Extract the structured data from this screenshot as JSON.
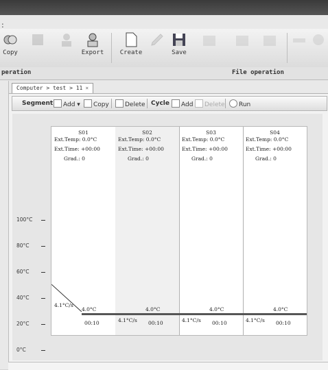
{
  "ribbon": {
    "buttons": [
      {
        "label": "Copy",
        "icon": "copy-icon",
        "enabled": true
      },
      {
        "label": "",
        "icon": "paste-icon",
        "enabled": false
      },
      {
        "label": "",
        "icon": "user-icon",
        "enabled": false
      },
      {
        "label": "Export",
        "icon": "export-icon",
        "enabled": true
      },
      {
        "label": "Create",
        "icon": "new-document-icon",
        "enabled": true
      },
      {
        "label": "",
        "icon": "edit-icon",
        "enabled": false
      },
      {
        "label": "Save",
        "icon": "save-icon",
        "enabled": true
      },
      {
        "label": "",
        "icon": "save-as-icon",
        "enabled": false
      },
      {
        "label": "",
        "icon": "import-icon",
        "enabled": false
      },
      {
        "label": "",
        "icon": "print-icon",
        "enabled": false
      }
    ],
    "groups": [
      "peration",
      "File operation"
    ]
  },
  "document_tab": {
    "label": "Computer > test > 11",
    "close": "×"
  },
  "segment_toolbar": {
    "segment_label": "Segment",
    "add_label": "Add",
    "copy_label": "Copy",
    "delete_label": "Delete",
    "cycle_label": "Cycle",
    "cycle_add_label": "Add",
    "cycle_delete_label": "Delete",
    "run_label": "Run"
  },
  "y_axis": [
    "100°C",
    "80°C",
    "60°C",
    "40°C",
    "20°C",
    "0°C"
  ],
  "segments": [
    {
      "name": "S01",
      "ext_temp": "Ext.Temp: 0.0°C",
      "ext_time": "Ext.Time: +00:00",
      "grad": "Grad.: 0",
      "rate": "4.1°C/s",
      "temp": "4.0°C",
      "time": "00:10",
      "selected": false
    },
    {
      "name": "S02",
      "ext_temp": "Ext.Temp: 0.0°C",
      "ext_time": "Ext.Time: +00:00",
      "grad": "Grad.: 0",
      "rate": "4.1°C/s",
      "temp": "4.0°C",
      "time": "00:10",
      "selected": true
    },
    {
      "name": "S03",
      "ext_temp": "Ext.Temp: 0.0°C",
      "ext_time": "Ext.Time: +00:00",
      "grad": "Grad.: 0",
      "rate": "4.1°C/s",
      "temp": "4.0°C",
      "time": "00:10",
      "selected": false
    },
    {
      "name": "S04",
      "ext_temp": "Ext.Temp: 0.0°C",
      "ext_time": "Ext.Time: +00:00",
      "grad": "Grad.: 0",
      "rate": "4.1°C/s",
      "temp": "4.0°C",
      "time": "00:10",
      "selected": false
    }
  ]
}
